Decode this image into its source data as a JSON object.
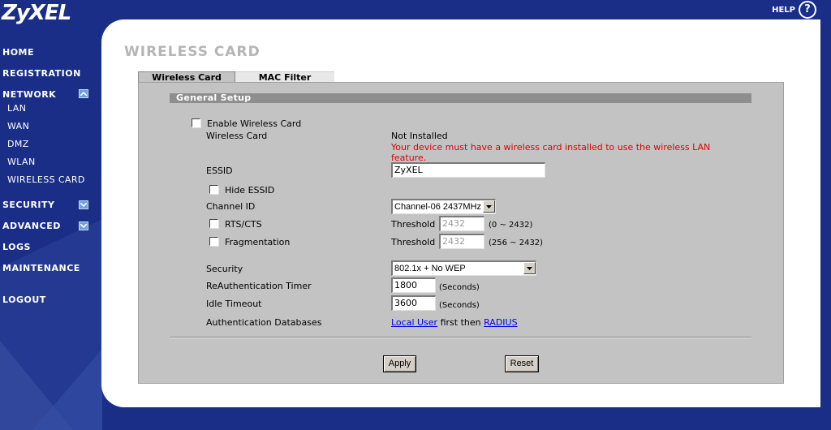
{
  "brand": {
    "logo": "ZyXEL"
  },
  "help": {
    "label": "HELP",
    "icon": "?"
  },
  "sidebar": {
    "home": "HOME",
    "registration": "REGISTRATION",
    "network": "NETWORK",
    "network_items": [
      "LAN",
      "WAN",
      "DMZ",
      "WLAN",
      "WIRELESS CARD"
    ],
    "security": "SECURITY",
    "advanced": "ADVANCED",
    "logs": "LOGS",
    "maintenance": "MAINTENANCE",
    "logout": "LOGOUT"
  },
  "page": {
    "title": "WIRELESS CARD"
  },
  "tabs": [
    {
      "label": "Wireless Card"
    },
    {
      "label": "MAC Filter"
    }
  ],
  "form": {
    "section_title": "General Setup",
    "enable_label": "Enable Wireless Card",
    "wireless_card_label": "Wireless Card",
    "wireless_card_status": "Not Installed",
    "warning_line1": "Your device must have a wireless card installed to use the wireless LAN",
    "warning_line2": "feature.",
    "essid_label": "ESSID",
    "essid_value": "ZyXEL",
    "hide_essid_label": "Hide ESSID",
    "channel_label": "Channel ID",
    "channel_value": "Channel-06 2437MHz",
    "rts_label": "RTS/CTS",
    "rts_threshold_label": "Threshold",
    "rts_threshold_value": "2432",
    "rts_range": "(0 ~ 2432)",
    "frag_label": "Fragmentation",
    "frag_threshold_label": "Threshold",
    "frag_threshold_value": "2432",
    "frag_range": "(256 ~ 2432)",
    "security_label": "Security",
    "security_value": "802.1x + No WEP",
    "reauth_label": "ReAuthentication Timer",
    "reauth_value": "1800",
    "reauth_unit": "(Seconds)",
    "idle_label": "Idle Timeout",
    "idle_value": "3600",
    "idle_unit": "(Seconds)",
    "authdb_label": "Authentication Databases",
    "authdb_link1": "Local User",
    "authdb_middle": " first then ",
    "authdb_link2": "RADIUS"
  },
  "buttons": {
    "apply": "Apply",
    "reset": "Reset"
  },
  "colors": {
    "background": "#1a2e88",
    "warning": "#e00000",
    "link": "#0000ee",
    "form_bg": "#c3c3c3"
  }
}
